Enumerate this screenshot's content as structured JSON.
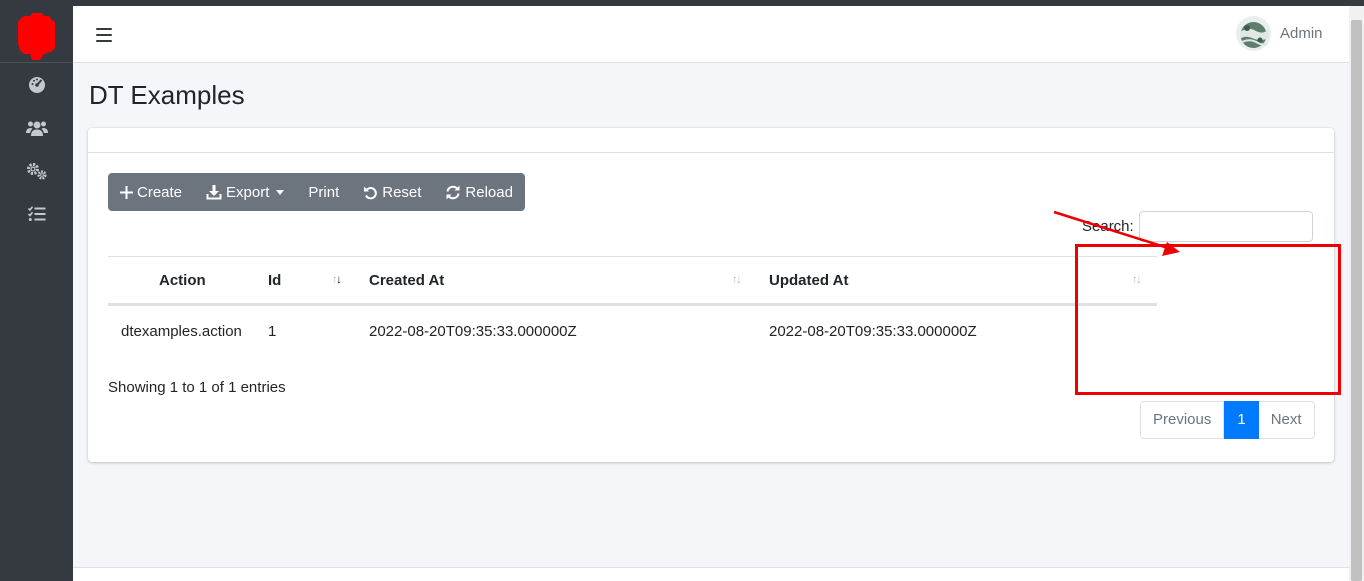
{
  "colors": {
    "sidebar_bg": "#343a40",
    "brand_mark": "#ff0000",
    "button_group_bg": "#6c757d",
    "pagination_active": "#007bff",
    "annotation": "#ee0000"
  },
  "sidebar": {
    "items": [
      {
        "icon": "tachometer-icon"
      },
      {
        "icon": "users-icon"
      },
      {
        "icon": "cogs-icon"
      },
      {
        "icon": "tasks-list-icon"
      }
    ]
  },
  "navbar": {
    "menu_icon": "bars-icon",
    "user_name": "Admin"
  },
  "page": {
    "title": "DT Examples"
  },
  "toolbar": {
    "create_label": "Create",
    "export_label": "Export",
    "print_label": "Print",
    "reset_label": "Reset",
    "reload_label": "Reload"
  },
  "search": {
    "label": "Search:",
    "value": ""
  },
  "table": {
    "columns": [
      "Action",
      "Id",
      "Created At",
      "Updated At"
    ],
    "rows": [
      [
        "dtexamples.action",
        "1",
        "2022-08-20T09:35:33.000000Z",
        "2022-08-20T09:35:33.000000Z"
      ]
    ]
  },
  "info": "Showing 1 to 1 of 1 entries",
  "pagination": {
    "previous": "Previous",
    "current": "1",
    "next": "Next"
  }
}
